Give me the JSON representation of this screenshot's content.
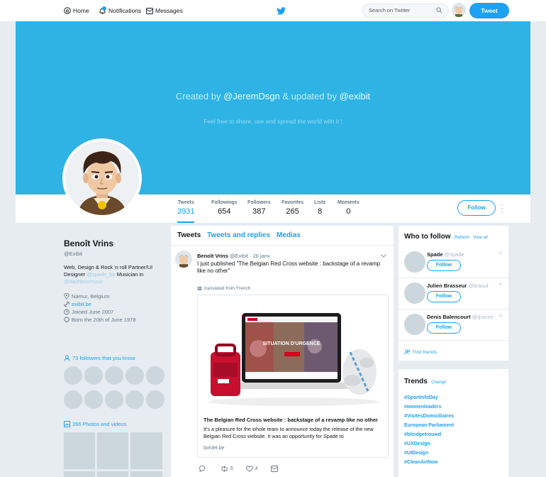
{
  "nav": {
    "home": "Home",
    "notifications": "Notifications",
    "messages": "Messages",
    "search_placeholder": "Search on Twitter",
    "tweet_button": "Tweet"
  },
  "banner": {
    "created_prefix": "Created by ",
    "created_author": "@JeremDsgn",
    "created_mid": " & updated by ",
    "updated_author": "@exibit",
    "tagline": "Feel free to share, use and spread the world with it !"
  },
  "stats": [
    {
      "label": "Tweets",
      "value": "3931"
    },
    {
      "label": "Followings",
      "value": "654"
    },
    {
      "label": "Followers",
      "value": "387"
    },
    {
      "label": "Favorites",
      "value": "265"
    },
    {
      "label": "Lists",
      "value": "8"
    },
    {
      "label": "Moments",
      "value": "0"
    }
  ],
  "follow_label": "Follow",
  "profile": {
    "name": "Benoît Vrins",
    "handle": "@Exibit",
    "bio_1": "Web, Design & Rock 'n roll Partner/UI Designer ",
    "bio_link1": "@spade_be",
    "bio_2": " Musician in ",
    "bio_link2": "@dashboxmusic",
    "location": "Namur, Belgium",
    "website": "exibit.be",
    "joined": "Joined June 2007",
    "born": "Born the 20th of June 1978",
    "followers_you_know": "73 followers that you know",
    "photos": "266 Photos and videos"
  },
  "feed": {
    "tabs": [
      "Tweets",
      "Tweets and replies",
      "Medias"
    ],
    "tweet": {
      "name": "Benoît Vrins",
      "handle": "@Exibit",
      "date": "· 26 janv",
      "text": "I just published \"The Belgian Red Cross website : backstage of a revamp like no other\"",
      "translated": "translated from French",
      "card_title": "The Belgian Red Cross website : backstage of a revamp like no other",
      "card_desc": "It's a pleasure for the whole team to announce today the release of the new Belgian Red Cross website. It was an opportunity for Spade to",
      "card_url": "bordet.be",
      "card_banner": "SITUATION D'URGENCE",
      "retweets": "6",
      "likes": "4"
    }
  },
  "who_to_follow": {
    "title": "Who to follow",
    "links": " · Refresh · View all",
    "items": [
      {
        "name": "Spade",
        "handle": "@spade"
      },
      {
        "name": "Julien Brasseur",
        "handle": "@brasul"
      },
      {
        "name": "Denis Balencourt",
        "handle": "@quinze"
      }
    ],
    "find_friends": "Find friends"
  },
  "trends": {
    "title": "Trends",
    "change": " · Change",
    "items": [
      "#SportInfoDay",
      "#womenleaders",
      "#VisitesDomiciliaires",
      "European Parliament",
      "#blindgetrouwd",
      "#UXDesign",
      "#UIDesign",
      "#CleanAirNow"
    ]
  },
  "colors": {
    "accent": "#1da1f2",
    "banner": "#2eb3e4",
    "background": "#e6ecf0"
  }
}
